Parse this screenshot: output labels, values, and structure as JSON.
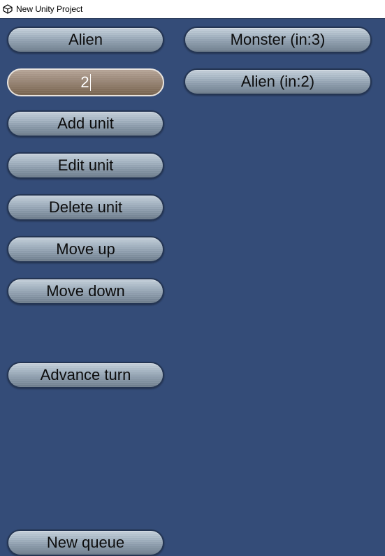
{
  "window": {
    "title": "New Unity Project",
    "icon": "unity-logo-icon"
  },
  "left_panel": {
    "unit_type_label": "Alien",
    "count_input_value": "2",
    "buttons": {
      "add_unit": "Add unit",
      "edit_unit": "Edit unit",
      "delete_unit": "Delete unit",
      "move_up": "Move up",
      "move_down": "Move down",
      "advance_turn": "Advance turn",
      "new_queue": "New queue"
    }
  },
  "queue": {
    "items": [
      {
        "label": "Monster (in:3)"
      },
      {
        "label": "Alien (in:2)"
      }
    ]
  },
  "colors": {
    "background": "#344c78",
    "button_metal": "#a9b8c6",
    "input_bronze": "#9d8a7b"
  }
}
